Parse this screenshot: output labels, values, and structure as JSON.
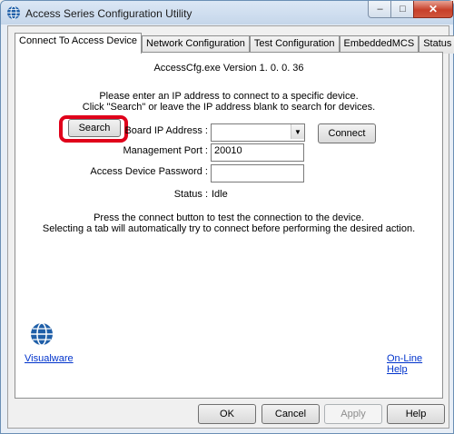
{
  "window": {
    "title": "Access Series Configuration Utility",
    "icon": "globe-icon",
    "controls": {
      "minimize": "–",
      "maximize": "□",
      "close": "✕"
    }
  },
  "tabs": [
    {
      "label": "Connect To Access Device",
      "active": true
    },
    {
      "label": "Network Configuration",
      "active": false
    },
    {
      "label": "Test Configuration",
      "active": false
    },
    {
      "label": "EmbeddedMCS",
      "active": false
    },
    {
      "label": "Status",
      "active": false
    }
  ],
  "panel": {
    "version": "AccessCfg.exe Version 1. 0. 0. 36",
    "instructions_line1": "Please enter an IP address to connect to a specific device.",
    "instructions_line2": "Click \"Search\" or leave the IP address blank to search for devices.",
    "search_button": "Search",
    "connect_button": "Connect",
    "board_ip_label": "Board IP Address :",
    "board_ip_value": "",
    "management_port_label": "Management Port :",
    "management_port_value": "20010",
    "password_label": "Access Device Password :",
    "password_value": "",
    "status_label": "Status :",
    "status_value": "Idle",
    "footer_line1": "Press the connect button to test the connection to the device.",
    "footer_line2": "Selecting a tab will automatically try to connect before performing the desired action.",
    "logo_link": "Visualware",
    "help_link": "On-Line Help"
  },
  "buttons": {
    "ok": "OK",
    "cancel": "Cancel",
    "apply": "Apply",
    "help": "Help"
  },
  "colors": {
    "highlight": "#e0001a",
    "link": "#0033cc",
    "logo": "#1f5fa8"
  }
}
